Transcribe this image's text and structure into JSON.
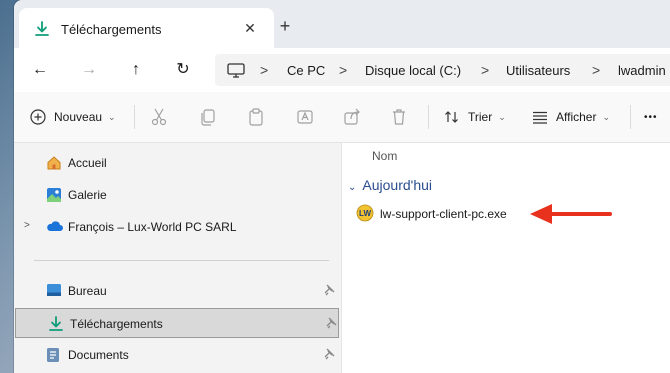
{
  "window": {
    "tab_title": "Téléchargements",
    "close_glyph": "✕",
    "new_tab_glyph": "+"
  },
  "nav": {
    "back_glyph": "←",
    "forward_glyph": "→",
    "up_glyph": "↑",
    "refresh_glyph": "↻",
    "breadcrumb": [
      "Ce PC",
      "Disque local (C:)",
      "Utilisateurs",
      "lwadmin"
    ],
    "separator": ">"
  },
  "toolbar": {
    "new_label": "Nouveau",
    "sort_label": "Trier",
    "view_label": "Afficher",
    "more_glyph": "•••"
  },
  "sidebar": {
    "items": [
      {
        "label": "Accueil",
        "icon": "home-icon"
      },
      {
        "label": "Galerie",
        "icon": "gallery-icon"
      },
      {
        "label": "François – Lux-World PC SARL",
        "icon": "onedrive-cloud-icon"
      },
      {
        "label": "Bureau",
        "icon": "desktop-icon",
        "pinned": true
      },
      {
        "label": "Téléchargements",
        "icon": "download-icon",
        "pinned": true,
        "selected": true
      },
      {
        "label": "Documents",
        "icon": "documents-icon",
        "pinned": true
      }
    ]
  },
  "content": {
    "column_header": "Nom",
    "group_label": "Aujourd'hui",
    "files": [
      {
        "name": "lw-support-client-pc.exe",
        "icon": "lw-app-icon"
      }
    ],
    "annotation_arrow_color": "#e8321e"
  },
  "colors": {
    "accent_download": "#0f9d7a",
    "group_text": "#2a4d8f",
    "selected_bg": "#d9d9d9"
  }
}
